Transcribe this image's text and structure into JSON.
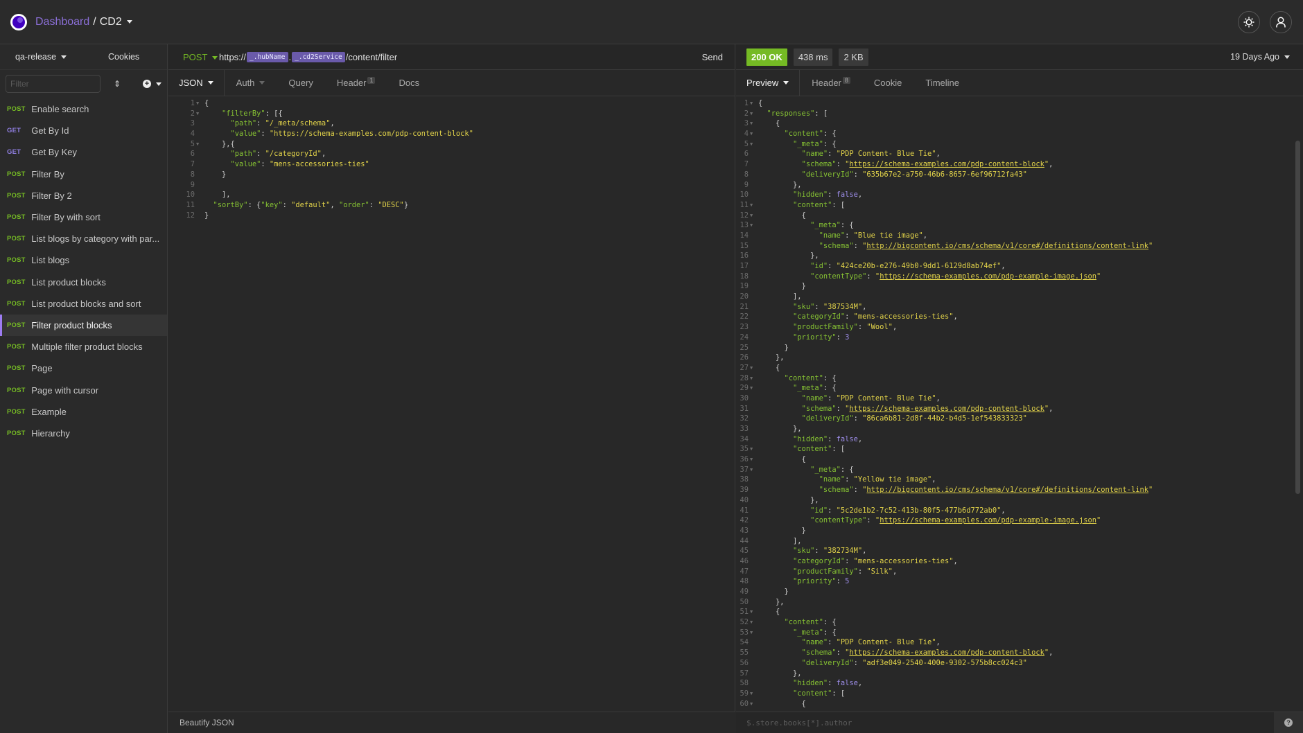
{
  "header": {
    "breadcrumb_root": "Dashboard",
    "breadcrumb_sep": "/",
    "workspace": "CD2",
    "icons": [
      "settings-icon",
      "user-icon"
    ]
  },
  "sidebar": {
    "environment": "qa-release",
    "cookies_label": "Cookies",
    "filter_placeholder": "Filter",
    "items": [
      {
        "method": "POST",
        "label": "Enable search"
      },
      {
        "method": "GET",
        "label": "Get By Id"
      },
      {
        "method": "GET",
        "label": "Get By Key"
      },
      {
        "method": "POST",
        "label": "Filter By"
      },
      {
        "method": "POST",
        "label": "Filter By 2"
      },
      {
        "method": "POST",
        "label": "Filter By with sort"
      },
      {
        "method": "POST",
        "label": "List blogs by category with par..."
      },
      {
        "method": "POST",
        "label": "List blogs"
      },
      {
        "method": "POST",
        "label": "List product blocks"
      },
      {
        "method": "POST",
        "label": "List product blocks and sort"
      },
      {
        "method": "POST",
        "label": "Filter product blocks",
        "active": true
      },
      {
        "method": "POST",
        "label": "Multiple filter product blocks"
      },
      {
        "method": "POST",
        "label": "Page"
      },
      {
        "method": "POST",
        "label": "Page with cursor"
      },
      {
        "method": "POST",
        "label": "Example"
      },
      {
        "method": "POST",
        "label": "Hierarchy"
      }
    ]
  },
  "request": {
    "method": "POST",
    "url_prefix": "https://",
    "url_var1": "_.hubName",
    "url_dot": ".",
    "url_var2": "_.cd2Service",
    "url_suffix": "/content/filter",
    "send_label": "Send",
    "tabs": [
      {
        "label": "JSON",
        "active": true
      },
      {
        "label": "Auth"
      },
      {
        "label": "Query"
      },
      {
        "label": "Header",
        "badge": "1"
      },
      {
        "label": "Docs"
      }
    ],
    "body_lines": [
      [
        [
          "p",
          "{"
        ]
      ],
      [
        [
          "p",
          "    "
        ],
        [
          "k",
          "\"filterBy\""
        ],
        [
          "p",
          ": [{"
        ]
      ],
      [
        [
          "p",
          "      "
        ],
        [
          "k",
          "\"path\""
        ],
        [
          "p",
          ": "
        ],
        [
          "s",
          "\"/_meta/schema\""
        ],
        [
          "p",
          ","
        ]
      ],
      [
        [
          "p",
          "      "
        ],
        [
          "k",
          "\"value\""
        ],
        [
          "p",
          ": "
        ],
        [
          "s",
          "\"https://schema-examples.com/pdp-content-block\""
        ]
      ],
      [
        [
          "p",
          "    },{"
        ]
      ],
      [
        [
          "p",
          "      "
        ],
        [
          "k",
          "\"path\""
        ],
        [
          "p",
          ": "
        ],
        [
          "s",
          "\"/categoryId\""
        ],
        [
          "p",
          ","
        ]
      ],
      [
        [
          "p",
          "      "
        ],
        [
          "k",
          "\"value\""
        ],
        [
          "p",
          ": "
        ],
        [
          "s",
          "\"mens-accessories-ties\""
        ]
      ],
      [
        [
          "p",
          "    }"
        ]
      ],
      [
        [
          "p",
          ""
        ]
      ],
      [
        [
          "p",
          "    ],"
        ]
      ],
      [
        [
          "p",
          "  "
        ],
        [
          "k",
          "\"sortBy\""
        ],
        [
          "p",
          ": {"
        ],
        [
          "k",
          "\"key\""
        ],
        [
          "p",
          ": "
        ],
        [
          "s",
          "\"default\""
        ],
        [
          "p",
          ", "
        ],
        [
          "k",
          "\"order\""
        ],
        [
          "p",
          ": "
        ],
        [
          "s",
          "\"DESC\""
        ],
        [
          "p",
          "}"
        ]
      ],
      [
        [
          "p",
          "}"
        ]
      ]
    ],
    "body_folds": [
      1,
      2,
      5
    ],
    "footer_label": "Beautify JSON"
  },
  "response": {
    "status": "200 OK",
    "time": "438 ms",
    "size": "2 KB",
    "age": "19 Days Ago",
    "tabs": [
      {
        "label": "Preview",
        "active": true
      },
      {
        "label": "Header",
        "badge": "8"
      },
      {
        "label": "Cookie"
      },
      {
        "label": "Timeline"
      }
    ],
    "body_lines": [
      [
        [
          "p",
          "{"
        ]
      ],
      [
        [
          "p",
          "  "
        ],
        [
          "k",
          "\"responses\""
        ],
        [
          "p",
          ": ["
        ]
      ],
      [
        [
          "p",
          "    {"
        ]
      ],
      [
        [
          "p",
          "      "
        ],
        [
          "k",
          "\"content\""
        ],
        [
          "p",
          ": {"
        ]
      ],
      [
        [
          "p",
          "        "
        ],
        [
          "k",
          "\"_meta\""
        ],
        [
          "p",
          ": {"
        ]
      ],
      [
        [
          "p",
          "          "
        ],
        [
          "k",
          "\"name\""
        ],
        [
          "p",
          ": "
        ],
        [
          "s",
          "\"PDP Content- Blue Tie\""
        ],
        [
          "p",
          ","
        ]
      ],
      [
        [
          "p",
          "          "
        ],
        [
          "k",
          "\"schema\""
        ],
        [
          "p",
          ": "
        ],
        [
          "s",
          "\""
        ],
        [
          "u",
          "https://schema-examples.com/pdp-content-block"
        ],
        [
          "s",
          "\""
        ],
        [
          "p",
          ","
        ]
      ],
      [
        [
          "p",
          "          "
        ],
        [
          "k",
          "\"deliveryId\""
        ],
        [
          "p",
          ": "
        ],
        [
          "s",
          "\"635b67e2-a750-46b6-8657-6ef96712fa43\""
        ]
      ],
      [
        [
          "p",
          "        },"
        ]
      ],
      [
        [
          "p",
          "        "
        ],
        [
          "k",
          "\"hidden\""
        ],
        [
          "p",
          ": "
        ],
        [
          "b",
          "false"
        ],
        [
          "p",
          ","
        ]
      ],
      [
        [
          "p",
          "        "
        ],
        [
          "k",
          "\"content\""
        ],
        [
          "p",
          ": ["
        ]
      ],
      [
        [
          "p",
          "          {"
        ]
      ],
      [
        [
          "p",
          "            "
        ],
        [
          "k",
          "\"_meta\""
        ],
        [
          "p",
          ": {"
        ]
      ],
      [
        [
          "p",
          "              "
        ],
        [
          "k",
          "\"name\""
        ],
        [
          "p",
          ": "
        ],
        [
          "s",
          "\"Blue tie image\""
        ],
        [
          "p",
          ","
        ]
      ],
      [
        [
          "p",
          "              "
        ],
        [
          "k",
          "\"schema\""
        ],
        [
          "p",
          ": "
        ],
        [
          "s",
          "\""
        ],
        [
          "u",
          "http://bigcontent.io/cms/schema/v1/core#/definitions/content-link"
        ],
        [
          "s",
          "\""
        ]
      ],
      [
        [
          "p",
          "            },"
        ]
      ],
      [
        [
          "p",
          "            "
        ],
        [
          "k",
          "\"id\""
        ],
        [
          "p",
          ": "
        ],
        [
          "s",
          "\"424ce20b-e276-49b0-9dd1-6129d8ab74ef\""
        ],
        [
          "p",
          ","
        ]
      ],
      [
        [
          "p",
          "            "
        ],
        [
          "k",
          "\"contentType\""
        ],
        [
          "p",
          ": "
        ],
        [
          "s",
          "\""
        ],
        [
          "u",
          "https://schema-examples.com/pdp-example-image.json"
        ],
        [
          "s",
          "\""
        ]
      ],
      [
        [
          "p",
          "          }"
        ]
      ],
      [
        [
          "p",
          "        ],"
        ]
      ],
      [
        [
          "p",
          "        "
        ],
        [
          "k",
          "\"sku\""
        ],
        [
          "p",
          ": "
        ],
        [
          "s",
          "\"387534M\""
        ],
        [
          "p",
          ","
        ]
      ],
      [
        [
          "p",
          "        "
        ],
        [
          "k",
          "\"categoryId\""
        ],
        [
          "p",
          ": "
        ],
        [
          "s",
          "\"mens-accessories-ties\""
        ],
        [
          "p",
          ","
        ]
      ],
      [
        [
          "p",
          "        "
        ],
        [
          "k",
          "\"productFamily\""
        ],
        [
          "p",
          ": "
        ],
        [
          "s",
          "\"Wool\""
        ],
        [
          "p",
          ","
        ]
      ],
      [
        [
          "p",
          "        "
        ],
        [
          "k",
          "\"priority\""
        ],
        [
          "p",
          ": "
        ],
        [
          "b",
          "3"
        ]
      ],
      [
        [
          "p",
          "      }"
        ]
      ],
      [
        [
          "p",
          "    },"
        ]
      ],
      [
        [
          "p",
          "    {"
        ]
      ],
      [
        [
          "p",
          "      "
        ],
        [
          "k",
          "\"content\""
        ],
        [
          "p",
          ": {"
        ]
      ],
      [
        [
          "p",
          "        "
        ],
        [
          "k",
          "\"_meta\""
        ],
        [
          "p",
          ": {"
        ]
      ],
      [
        [
          "p",
          "          "
        ],
        [
          "k",
          "\"name\""
        ],
        [
          "p",
          ": "
        ],
        [
          "s",
          "\"PDP Content- Blue Tie\""
        ],
        [
          "p",
          ","
        ]
      ],
      [
        [
          "p",
          "          "
        ],
        [
          "k",
          "\"schema\""
        ],
        [
          "p",
          ": "
        ],
        [
          "s",
          "\""
        ],
        [
          "u",
          "https://schema-examples.com/pdp-content-block"
        ],
        [
          "s",
          "\""
        ],
        [
          "p",
          ","
        ]
      ],
      [
        [
          "p",
          "          "
        ],
        [
          "k",
          "\"deliveryId\""
        ],
        [
          "p",
          ": "
        ],
        [
          "s",
          "\"86ca6b81-2d8f-44b2-b4d5-1ef543833323\""
        ]
      ],
      [
        [
          "p",
          "        },"
        ]
      ],
      [
        [
          "p",
          "        "
        ],
        [
          "k",
          "\"hidden\""
        ],
        [
          "p",
          ": "
        ],
        [
          "b",
          "false"
        ],
        [
          "p",
          ","
        ]
      ],
      [
        [
          "p",
          "        "
        ],
        [
          "k",
          "\"content\""
        ],
        [
          "p",
          ": ["
        ]
      ],
      [
        [
          "p",
          "          {"
        ]
      ],
      [
        [
          "p",
          "            "
        ],
        [
          "k",
          "\"_meta\""
        ],
        [
          "p",
          ": {"
        ]
      ],
      [
        [
          "p",
          "              "
        ],
        [
          "k",
          "\"name\""
        ],
        [
          "p",
          ": "
        ],
        [
          "s",
          "\"Yellow tie image\""
        ],
        [
          "p",
          ","
        ]
      ],
      [
        [
          "p",
          "              "
        ],
        [
          "k",
          "\"schema\""
        ],
        [
          "p",
          ": "
        ],
        [
          "s",
          "\""
        ],
        [
          "u",
          "http://bigcontent.io/cms/schema/v1/core#/definitions/content-link"
        ],
        [
          "s",
          "\""
        ]
      ],
      [
        [
          "p",
          "            },"
        ]
      ],
      [
        [
          "p",
          "            "
        ],
        [
          "k",
          "\"id\""
        ],
        [
          "p",
          ": "
        ],
        [
          "s",
          "\"5c2de1b2-7c52-413b-80f5-477b6d772ab0\""
        ],
        [
          "p",
          ","
        ]
      ],
      [
        [
          "p",
          "            "
        ],
        [
          "k",
          "\"contentType\""
        ],
        [
          "p",
          ": "
        ],
        [
          "s",
          "\""
        ],
        [
          "u",
          "https://schema-examples.com/pdp-example-image.json"
        ],
        [
          "s",
          "\""
        ]
      ],
      [
        [
          "p",
          "          }"
        ]
      ],
      [
        [
          "p",
          "        ],"
        ]
      ],
      [
        [
          "p",
          "        "
        ],
        [
          "k",
          "\"sku\""
        ],
        [
          "p",
          ": "
        ],
        [
          "s",
          "\"382734M\""
        ],
        [
          "p",
          ","
        ]
      ],
      [
        [
          "p",
          "        "
        ],
        [
          "k",
          "\"categoryId\""
        ],
        [
          "p",
          ": "
        ],
        [
          "s",
          "\"mens-accessories-ties\""
        ],
        [
          "p",
          ","
        ]
      ],
      [
        [
          "p",
          "        "
        ],
        [
          "k",
          "\"productFamily\""
        ],
        [
          "p",
          ": "
        ],
        [
          "s",
          "\"Silk\""
        ],
        [
          "p",
          ","
        ]
      ],
      [
        [
          "p",
          "        "
        ],
        [
          "k",
          "\"priority\""
        ],
        [
          "p",
          ": "
        ],
        [
          "b",
          "5"
        ]
      ],
      [
        [
          "p",
          "      }"
        ]
      ],
      [
        [
          "p",
          "    },"
        ]
      ],
      [
        [
          "p",
          "    {"
        ]
      ],
      [
        [
          "p",
          "      "
        ],
        [
          "k",
          "\"content\""
        ],
        [
          "p",
          ": {"
        ]
      ],
      [
        [
          "p",
          "        "
        ],
        [
          "k",
          "\"_meta\""
        ],
        [
          "p",
          ": {"
        ]
      ],
      [
        [
          "p",
          "          "
        ],
        [
          "k",
          "\"name\""
        ],
        [
          "p",
          ": "
        ],
        [
          "s",
          "\"PDP Content- Blue Tie\""
        ],
        [
          "p",
          ","
        ]
      ],
      [
        [
          "p",
          "          "
        ],
        [
          "k",
          "\"schema\""
        ],
        [
          "p",
          ": "
        ],
        [
          "s",
          "\""
        ],
        [
          "u",
          "https://schema-examples.com/pdp-content-block"
        ],
        [
          "s",
          "\""
        ],
        [
          "p",
          ","
        ]
      ],
      [
        [
          "p",
          "          "
        ],
        [
          "k",
          "\"deliveryId\""
        ],
        [
          "p",
          ": "
        ],
        [
          "s",
          "\"adf3e049-2540-400e-9302-575b8cc024c3\""
        ]
      ],
      [
        [
          "p",
          "        },"
        ]
      ],
      [
        [
          "p",
          "        "
        ],
        [
          "k",
          "\"hidden\""
        ],
        [
          "p",
          ": "
        ],
        [
          "b",
          "false"
        ],
        [
          "p",
          ","
        ]
      ],
      [
        [
          "p",
          "        "
        ],
        [
          "k",
          "\"content\""
        ],
        [
          "p",
          ": ["
        ]
      ],
      [
        [
          "p",
          "          {"
        ]
      ]
    ],
    "body_folds": [
      1,
      2,
      3,
      4,
      5,
      11,
      12,
      13,
      27,
      28,
      29,
      35,
      36,
      37,
      51,
      52,
      53,
      59,
      60
    ],
    "filter_placeholder": "$.store.books[*].author",
    "help_label": "?"
  }
}
